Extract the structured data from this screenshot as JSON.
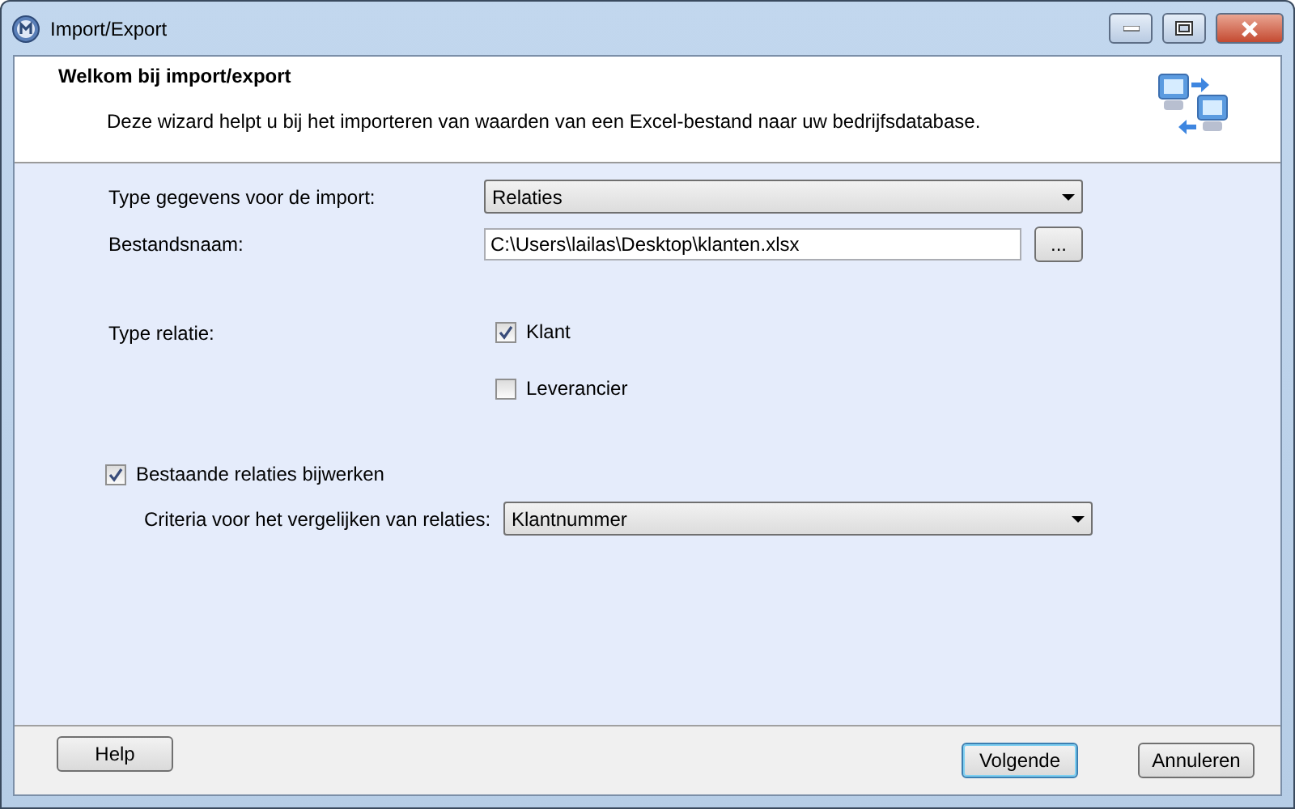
{
  "window": {
    "title": "Import/Export"
  },
  "header": {
    "title": "Welkom bij import/export",
    "description": "Deze wizard helpt u bij het importeren van waarden van een Excel-bestand naar uw bedrijfsdatabase."
  },
  "import_type": {
    "label": "Type gegevens voor de import:",
    "value": "Relaties"
  },
  "file_name": {
    "label": "Bestandsnaam:",
    "value": "C:\\Users\\lailas\\Desktop\\klanten.xlsx",
    "browse_button": "..."
  },
  "relation_type": {
    "label": "Type relatie:",
    "options": [
      {
        "label": "Klant",
        "checked": true
      },
      {
        "label": "Leverancier",
        "checked": false
      }
    ]
  },
  "update_existing": {
    "label": "Bestaande relaties bijwerken",
    "checked": true
  },
  "criteria": {
    "label": "Criteria voor het vergelijken van relaties:",
    "value": "Klantnummer"
  },
  "buttons": [
    {
      "label": "Help",
      "kind": "help"
    },
    {
      "label": "Volgende",
      "kind": "default"
    },
    {
      "label": "Annuleren",
      "kind": "normal"
    }
  ]
}
